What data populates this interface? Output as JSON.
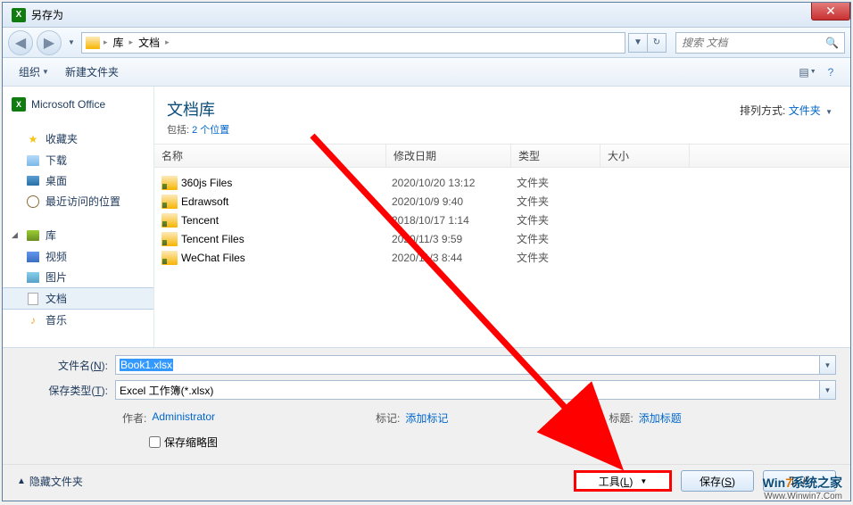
{
  "window": {
    "title": "另存为"
  },
  "nav": {
    "crumbs": [
      "库",
      "文档"
    ],
    "search_placeholder": "搜索 文档"
  },
  "toolbar": {
    "organize": "组织",
    "new_folder": "新建文件夹"
  },
  "sidebar": {
    "ms_office": "Microsoft Office",
    "favorites": "收藏夹",
    "downloads": "下载",
    "desktop": "桌面",
    "recent": "最近访问的位置",
    "libraries": "库",
    "videos": "视频",
    "pictures": "图片",
    "documents": "文档",
    "music": "音乐"
  },
  "library": {
    "title": "文档库",
    "includes_label": "包括:",
    "includes_link": "2 个位置",
    "arrange_label": "排列方式:",
    "arrange_value": "文件夹"
  },
  "columns": {
    "name": "名称",
    "date": "修改日期",
    "type": "类型",
    "size": "大小"
  },
  "files": [
    {
      "name": "360js Files",
      "date": "2020/10/20 13:12",
      "type": "文件夹"
    },
    {
      "name": "Edrawsoft",
      "date": "2020/10/9 9:40",
      "type": "文件夹"
    },
    {
      "name": "Tencent",
      "date": "2018/10/17 1:14",
      "type": "文件夹"
    },
    {
      "name": "Tencent Files",
      "date": "2020/11/3 9:59",
      "type": "文件夹"
    },
    {
      "name": "WeChat Files",
      "date": "2020/11/3 8:44",
      "type": "文件夹"
    }
  ],
  "form": {
    "filename_label": "文件名(N):",
    "filename_value": "Book1.xlsx",
    "filetype_label": "保存类型(T):",
    "filetype_value": "Excel 工作簿(*.xlsx)",
    "author_label": "作者:",
    "author_value": "Administrator",
    "tags_label": "标记:",
    "tags_value": "添加标记",
    "title_label": "标题:",
    "title_value": "添加标题",
    "thumbnail_label": "保存缩略图"
  },
  "footer": {
    "hide_folders": "隐藏文件夹",
    "tools": "工具(L)",
    "save": "保存(S)",
    "cancel": "取消"
  },
  "watermark": {
    "line1a": "Win",
    "line1b": "7",
    "line1c": "系统之家",
    "line2": "Www.Winwin7.Com"
  }
}
